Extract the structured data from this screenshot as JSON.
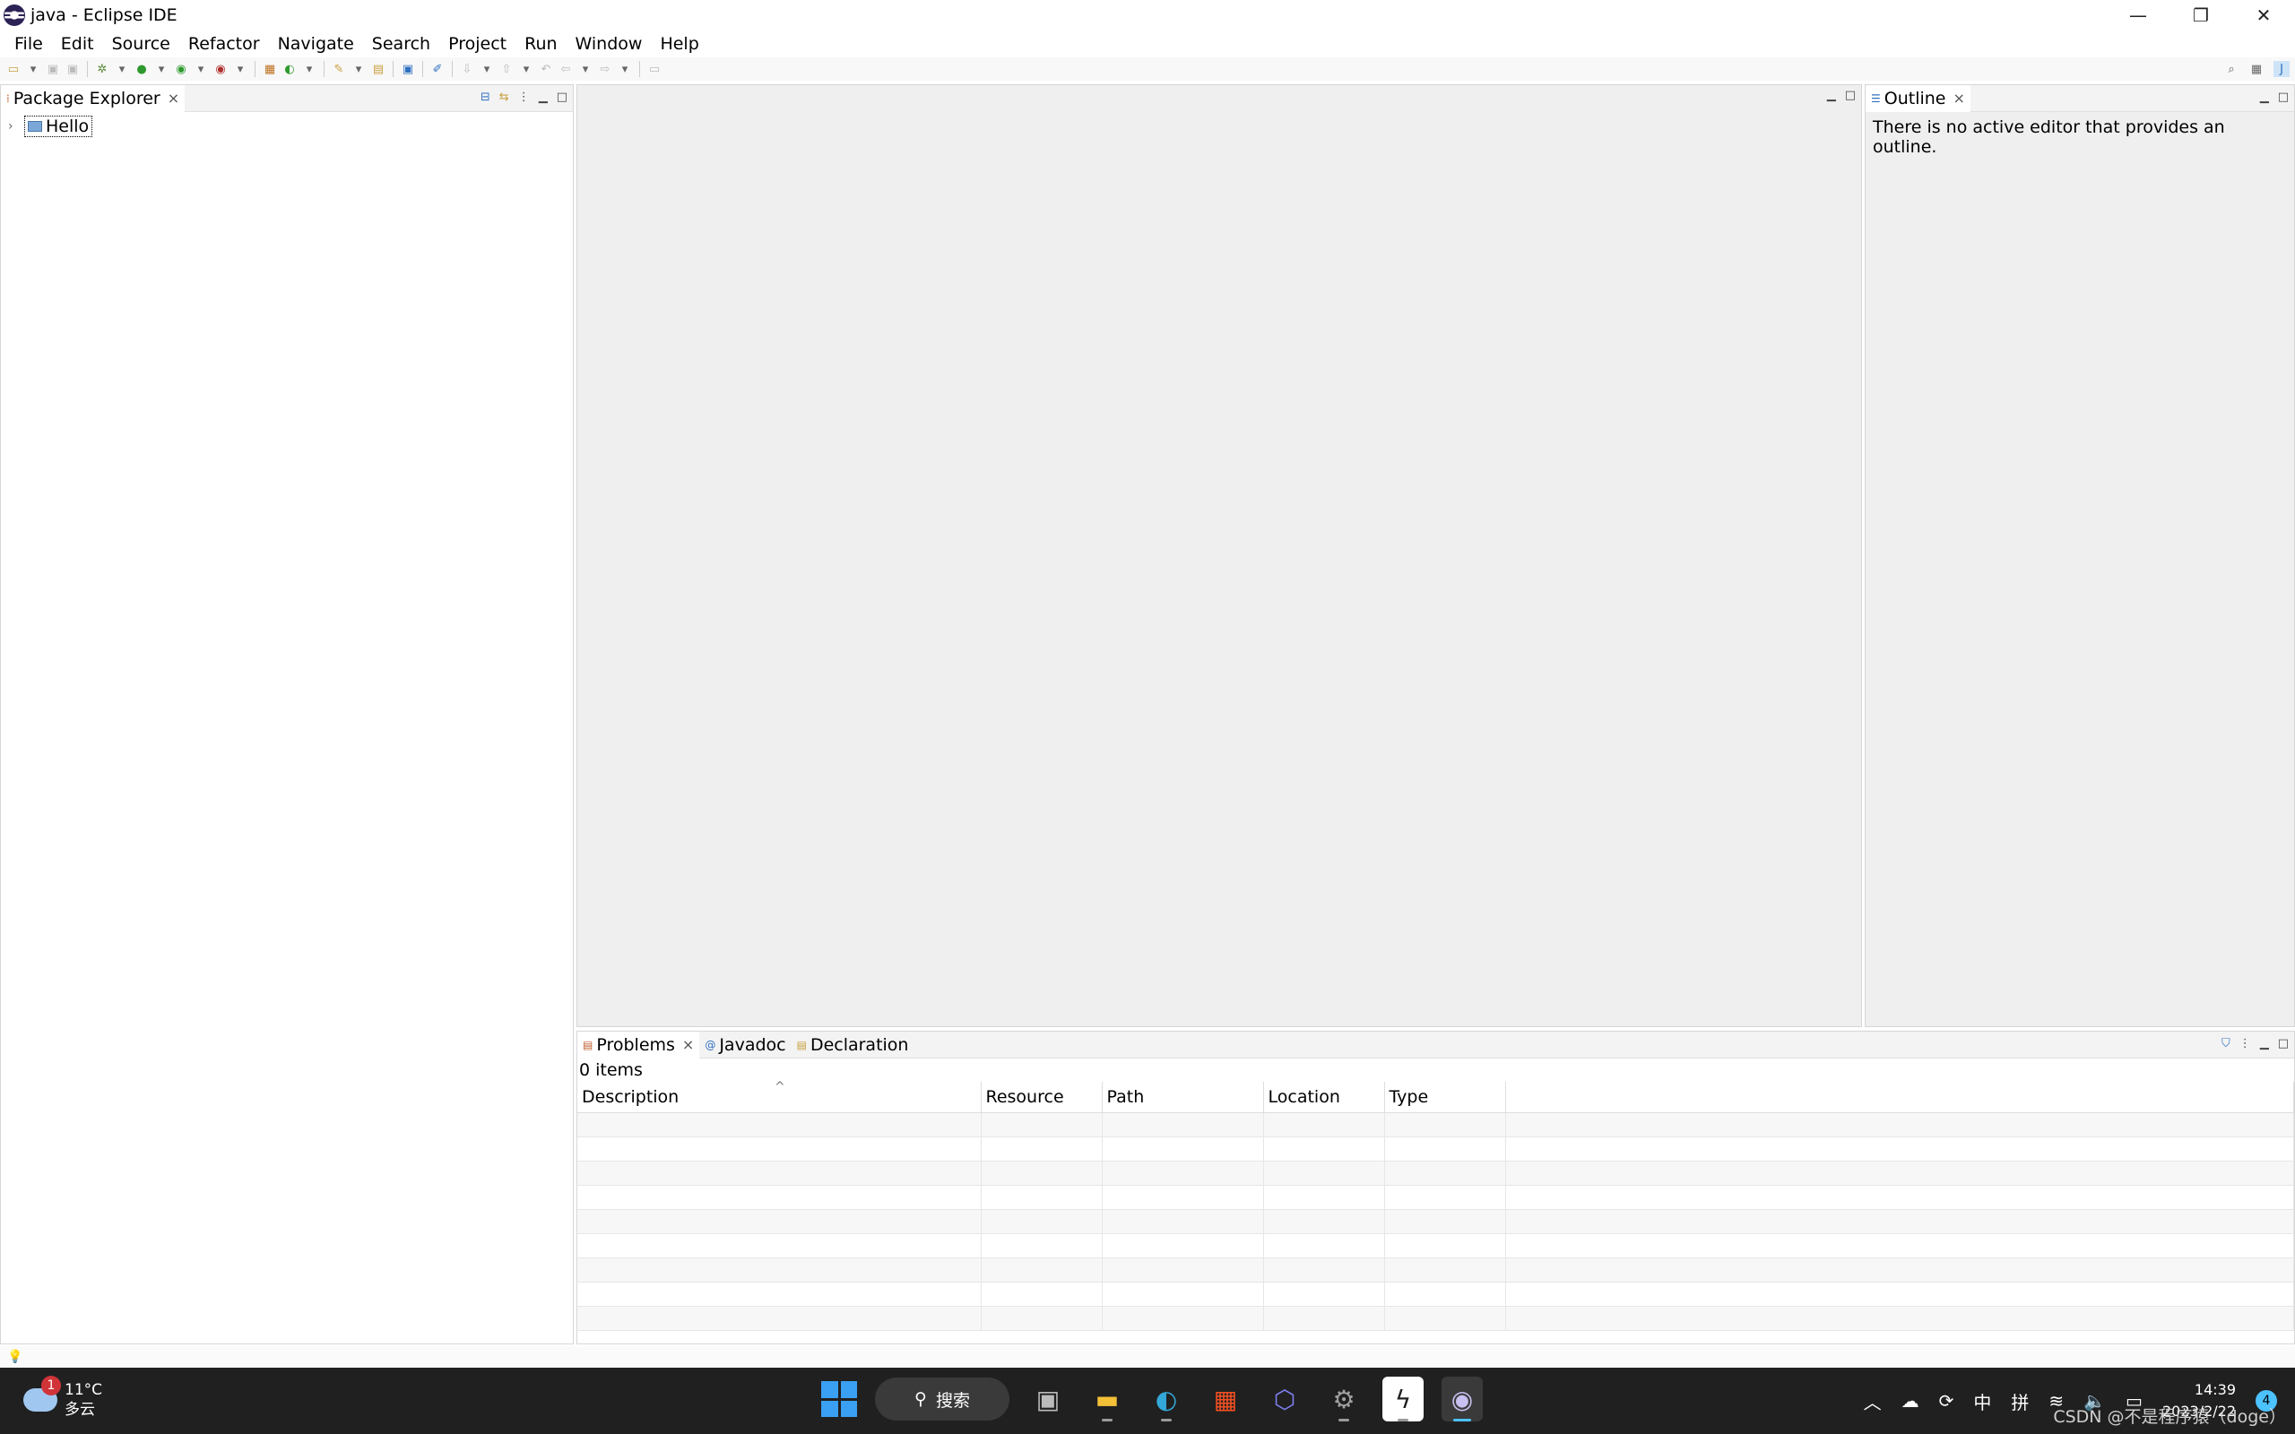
{
  "window": {
    "title": "java - Eclipse IDE",
    "controls": {
      "minimize": "—",
      "restore": "❐",
      "close": "✕"
    }
  },
  "menu": [
    "File",
    "Edit",
    "Source",
    "Refactor",
    "Navigate",
    "Search",
    "Project",
    "Run",
    "Window",
    "Help"
  ],
  "package_explorer": {
    "tab_label": "Package Explorer",
    "items": [
      {
        "label": "Hello",
        "icon": "java-project-icon"
      }
    ]
  },
  "outline": {
    "tab_label": "Outline",
    "message": "There is no active editor that provides an outline."
  },
  "bottom_panel": {
    "tabs": [
      {
        "label": "Problems",
        "icon": "problems-icon"
      },
      {
        "label": "Javadoc",
        "icon": "javadoc-icon"
      },
      {
        "label": "Declaration",
        "icon": "declaration-icon"
      }
    ],
    "items_count": "0 items",
    "columns": [
      "Description",
      "Resource",
      "Path",
      "Location",
      "Type"
    ]
  },
  "taskbar": {
    "weather": {
      "badge": "1",
      "temp": "11°C",
      "condition": "多云"
    },
    "search_label": "搜索",
    "tray": {
      "ime_lang": "中",
      "ime_mode": "拼",
      "time": "14:39",
      "date": "2023/2/22",
      "notifications": "4"
    }
  },
  "watermark": "CSDN @不是程序猿（doge）",
  "colors": {
    "taskbar_bg": "#202020",
    "accent": "#4cc2ff",
    "editor_bg": "#efefef"
  }
}
